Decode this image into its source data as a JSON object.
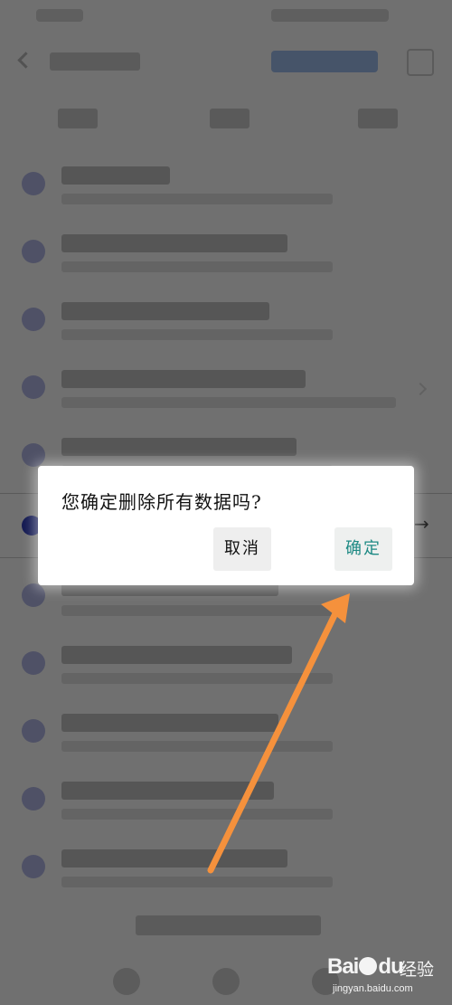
{
  "dialog": {
    "message": "您确定删除所有数据吗?",
    "cancel_label": "取消",
    "confirm_label": "确定"
  },
  "watermark": {
    "brand_text": "Bai",
    "brand_text_tail": "du",
    "brand_suffix": "经验",
    "site": "jingyan.baidu.com"
  },
  "annotation": {
    "arrow_color": "#f5913c"
  }
}
